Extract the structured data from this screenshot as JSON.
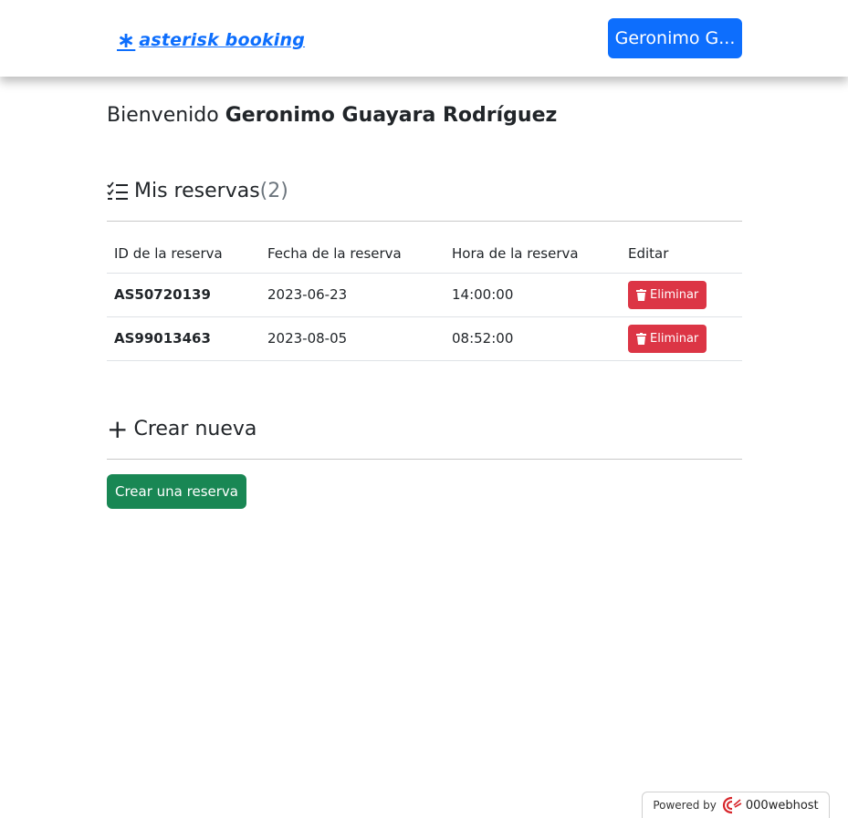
{
  "navbar": {
    "brand_symbol": "∗",
    "brand_text": "asterisk booking",
    "user_button": "Geronimo G..."
  },
  "welcome": {
    "greeting": "Bienvenido",
    "user_name": "Geronimo Guayara Rodríguez"
  },
  "reservas": {
    "title": "Mis reservas",
    "count": "(2)",
    "headers": [
      "ID de la reserva",
      "Fecha de la reserva",
      "Hora de la reserva",
      "Editar"
    ],
    "rows": [
      {
        "id": "AS50720139",
        "fecha": "2023-06-23",
        "hora": "14:00:00",
        "action": "Eliminar"
      },
      {
        "id": "AS99013463",
        "fecha": "2023-08-05",
        "hora": "08:52:00",
        "action": "Eliminar"
      }
    ]
  },
  "crear": {
    "title": "Crear nueva",
    "button": "Crear una reserva"
  },
  "footer": {
    "powered_by": "Powered by",
    "host": "000webhost"
  },
  "colors": {
    "primary": "#0d6efd",
    "danger": "#dc3545",
    "success": "#198754"
  }
}
